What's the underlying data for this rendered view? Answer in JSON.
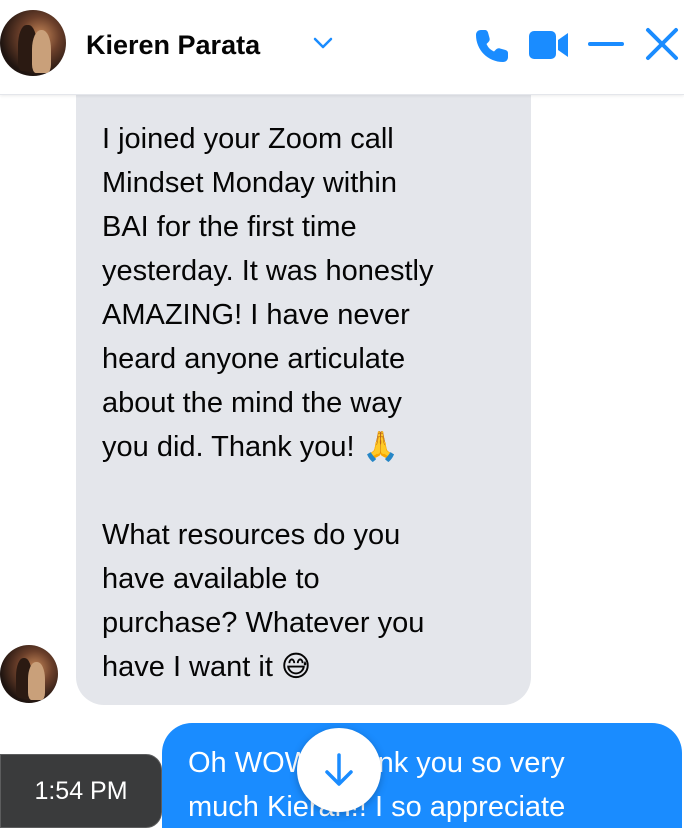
{
  "header": {
    "contact_name": "Kieren Parata",
    "avatar_icon": "profile-photo",
    "icons": [
      "chevron-down-icon",
      "phone-icon",
      "video-icon",
      "minimize-icon",
      "close-icon"
    ],
    "accent_color": "#1a8cff"
  },
  "messages": [
    {
      "direction": "incoming",
      "text": "I joined your Zoom call\nMindset Monday within\nBAI for the first time\nyesterday. It was honestly\nAMAZING! I have never\nheard anyone articulate\nabout the mind the way\nyou did. Thank you! 🙏\n\nWhat resources do you\nhave available to\npurchase? Whatever you\nhave I want it 😅"
    },
    {
      "direction": "outgoing",
      "text": "Oh WOW! Thank you so very\nmuch Kieran!! I so appreciate"
    }
  ],
  "timestamp": "1:54 PM",
  "scroll_button_icon": "arrow-down-icon"
}
